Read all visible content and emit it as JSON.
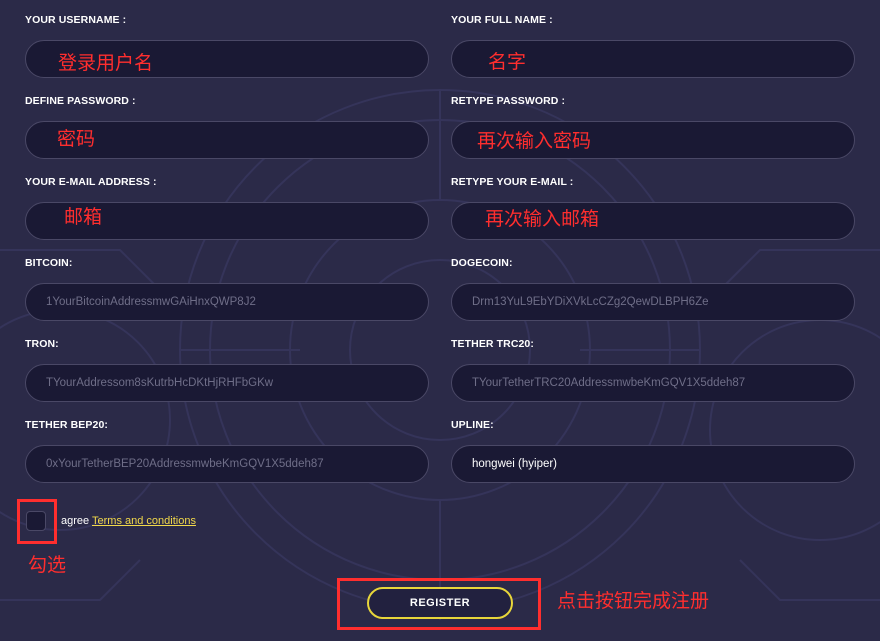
{
  "form": {
    "username": {
      "label": "YOUR USERNAME :",
      "annotation": "登录用户名"
    },
    "full_name": {
      "label": "YOUR FULL NAME :",
      "annotation": "名字"
    },
    "password": {
      "label": "DEFINE PASSWORD :",
      "annotation": "密码"
    },
    "retype_password": {
      "label": "RETYPE PASSWORD :",
      "annotation": "再次输入密码"
    },
    "email": {
      "label": "YOUR E-MAIL ADDRESS :",
      "annotation": "邮箱"
    },
    "retype_email": {
      "label": "RETYPE YOUR E-MAIL :",
      "annotation": "再次输入邮箱"
    },
    "bitcoin": {
      "label": "BITCOIN:",
      "placeholder": "1YourBitcoinAddressmwGAiHnxQWP8J2"
    },
    "dogecoin": {
      "label": "DOGECOIN:",
      "placeholder": "Drm13YuL9EbYDiXVkLcCZg2QewDLBPH6Ze"
    },
    "tron": {
      "label": "TRON:",
      "placeholder": "TYourAddressom8sKutrbHcDKtHjRHFbGKw"
    },
    "tether_trc20": {
      "label": "TETHER TRC20:",
      "placeholder": "TYourTetherTRC20AddressmwbeKmGQV1X5ddeh87"
    },
    "tether_bep20": {
      "label": "TETHER BEP20:",
      "placeholder": "0xYourTetherBEP20AddressmwbeKmGQV1X5ddeh87"
    },
    "upline": {
      "label": "UPLINE:",
      "value": "hongwei (hyiper)"
    }
  },
  "agree": {
    "text": "agree",
    "terms_link": "Terms and conditions",
    "annotation": "勾选"
  },
  "register": {
    "label": "REGISTER",
    "annotation": "点击按钮完成注册"
  },
  "colors": {
    "background": "#2b2a48",
    "input_bg": "#1a1934",
    "accent_yellow": "#e8d63a",
    "annotation_red": "#ff2e2e"
  }
}
